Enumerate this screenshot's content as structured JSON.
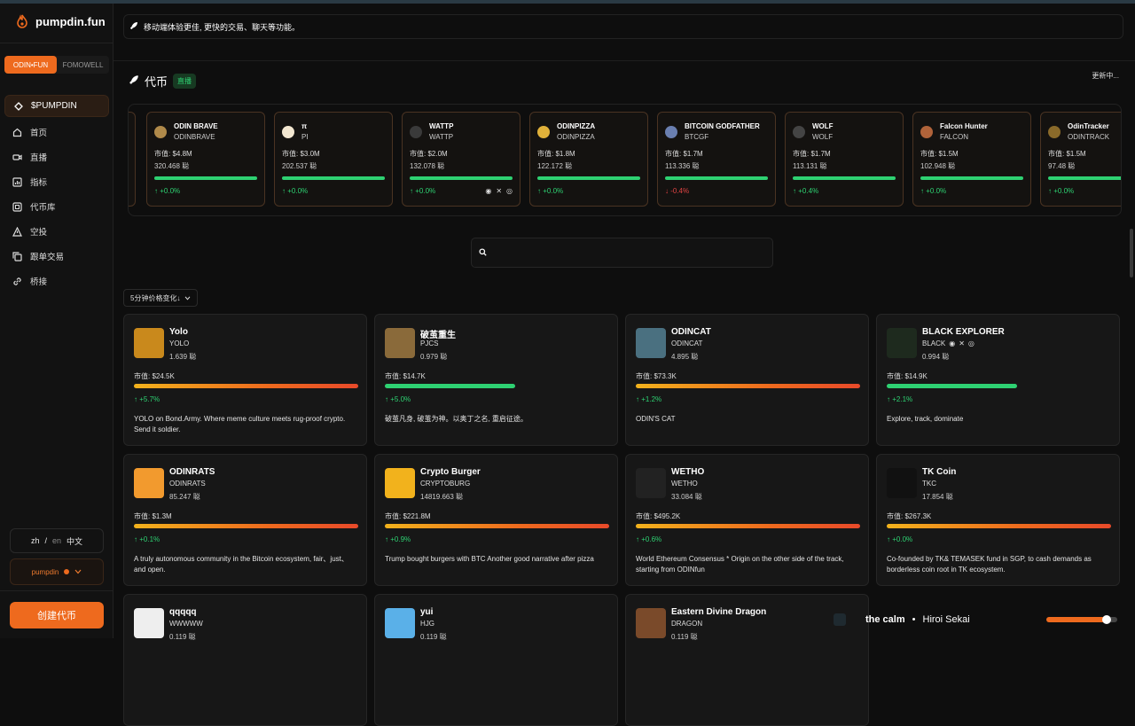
{
  "app": {
    "name": "pumpdin.fun"
  },
  "sidebar": {
    "switch": [
      "ODIN•FUN",
      "FOMOWELL"
    ],
    "items": [
      {
        "label": "$PUMPDIN",
        "icon": "diamond-icon"
      },
      {
        "label": "首页",
        "icon": "home-icon"
      },
      {
        "label": "直播",
        "icon": "video-icon"
      },
      {
        "label": "指标",
        "icon": "chart-icon"
      },
      {
        "label": "代币库",
        "icon": "library-icon"
      },
      {
        "label": "空投",
        "icon": "airdrop-icon"
      },
      {
        "label": "跟单交易",
        "icon": "copy-icon"
      },
      {
        "label": "桥接",
        "icon": "link-icon"
      }
    ],
    "lang": {
      "zh": "zh",
      "sep": "/",
      "en": "en",
      "current": "中文"
    },
    "user": "pumpdin",
    "create_label": "创建代币"
  },
  "banner": {
    "text": "移动端体验更佳, 更快的交易、聊天等功能。"
  },
  "section": {
    "title": "代币",
    "badge": "直播",
    "updating": "更新中..."
  },
  "ticker": [
    {
      "name": "ODIN BRAVE",
      "symbol": "ODINBRAVE",
      "cap": "市值: $4.8M",
      "holders": "320.468 聪",
      "change": "↑ +0.0%",
      "color": "#b08a4a"
    },
    {
      "name": "π",
      "symbol": "PI",
      "cap": "市值: $3.0M",
      "holders": "202.537 聪",
      "change": "↑ +0.0%",
      "color": "#f2e6d0"
    },
    {
      "name": "WATTP",
      "symbol": "WATTP",
      "cap": "市值: $2.0M",
      "holders": "132.078 聪",
      "change": "↑ +0.0%",
      "color": "#3a3a3a",
      "social": true
    },
    {
      "name": "ODINPIZZA",
      "symbol": "ODINPIZZA",
      "cap": "市值: $1.8M",
      "holders": "122.172 聪",
      "change": "↑ +0.0%",
      "color": "#e0b13a"
    },
    {
      "name": "BITCOIN GODFATHER",
      "symbol": "BTCGF",
      "cap": "市值: $1.7M",
      "holders": "113.336 聪",
      "change": "↓ -0.4%",
      "color": "#6a7fb0",
      "neg": true
    },
    {
      "name": "WOLF",
      "symbol": "WOLF",
      "cap": "市值: $1.7M",
      "holders": "113.131 聪",
      "change": "↑ +0.4%",
      "color": "#444"
    },
    {
      "name": "Falcon Hunter",
      "symbol": "FALCON",
      "cap": "市值: $1.5M",
      "holders": "102.948 聪",
      "change": "↑ +0.0%",
      "color": "#b0633a"
    },
    {
      "name": "OdinTracker",
      "symbol": "ODINTRACK",
      "cap": "市值: $1.5M",
      "holders": "97.48 聪",
      "change": "↑ +0.0%",
      "color": "#8a6a2a"
    }
  ],
  "search": {
    "placeholder": ""
  },
  "sort": {
    "label": "5分钟价格变化↓"
  },
  "cards": [
    {
      "name": "Yolo",
      "symbol": "YOLO",
      "holders": "1.639 聪",
      "cap": "市值: $24.5K",
      "change": "↑ +5.7%",
      "desc": "YOLO on Bond.Army. Where meme culture meets rug-proof crypto. Send it soldier.",
      "bar": "orange",
      "progress": 1.0,
      "color": "#c9891c"
    },
    {
      "name": "破茧重生",
      "symbol": "PJCS",
      "holders": "0.979 聪",
      "cap": "市值: $14.7K",
      "change": "↑ +5.0%",
      "desc": "破茧凡身, 破茧为神。以奥丁之名, 重启征途。",
      "bar": "green",
      "progress": 0.58,
      "color": "#8a6a3a"
    },
    {
      "name": "ODINCAT",
      "symbol": "ODINCAT",
      "holders": "4.895 聪",
      "cap": "市值: $73.3K",
      "change": "↑ +1.2%",
      "desc": "ODIN'S CAT",
      "bar": "orange",
      "progress": 1.0,
      "color": "#4a7080"
    },
    {
      "name": "BLACK EXPLORER",
      "symbol": "BLACK",
      "holders": "0.994 聪",
      "cap": "市值: $14.9K",
      "change": "↑ +2.1%",
      "desc": "Explore, track, dominate",
      "bar": "green",
      "progress": 0.58,
      "color": "#1e2a1e",
      "social": true
    },
    {
      "name": "ODINRATS",
      "symbol": "ODINRATS",
      "holders": "85.247 聪",
      "cap": "市值: $1.3M",
      "change": "↑ +0.1%",
      "desc": "A truly autonomous community in the Bitcoin ecosystem, fair、just、and open.",
      "bar": "orange",
      "progress": 1.0,
      "color": "#f29a2e"
    },
    {
      "name": "Crypto Burger",
      "symbol": "CRYPTOBURG",
      "holders": "14819.663 聪",
      "cap": "市值: $221.8M",
      "change": "↑ +0.9%",
      "desc": "Trump bought burgers with BTC Another good narrative after pizza",
      "bar": "orange",
      "progress": 1.0,
      "color": "#f2b21c"
    },
    {
      "name": "WETHO",
      "symbol": "WETHO",
      "holders": "33.084 聪",
      "cap": "市值: $495.2K",
      "change": "↑ +0.6%",
      "desc": "World Ethereum Consensus * Origin on the other side of the track, starting from ODINfun",
      "bar": "orange",
      "progress": 1.0,
      "color": "#222"
    },
    {
      "name": "TK Coin",
      "symbol": "TKC",
      "holders": "17.854 聪",
      "cap": "市值: $267.3K",
      "change": "↑ +0.0%",
      "desc": "Co-founded by TK& TEMASEK fund in SGP, to cash demands as borderless coin root in TK ecosystem.",
      "bar": "orange",
      "progress": 1.0,
      "color": "#111"
    },
    {
      "name": "qqqqq",
      "symbol": "WWWWW",
      "holders": "0.119 聪",
      "cap": "",
      "change": "",
      "desc": "",
      "bar": "none",
      "progress": 0,
      "color": "#eee"
    },
    {
      "name": "yui",
      "symbol": "HJG",
      "holders": "0.119 聪",
      "cap": "",
      "change": "",
      "desc": "",
      "bar": "none",
      "progress": 0,
      "color": "#5ab0e8"
    },
    {
      "name": "Eastern Divine Dragon",
      "symbol": "DRAGON",
      "holders": "0.119 聪",
      "cap": "",
      "change": "",
      "desc": "",
      "bar": "none",
      "progress": 0,
      "color": "#7a4a2a"
    }
  ],
  "player": {
    "track": "the calm",
    "dot": "•",
    "artist": "Hiroi Sekai",
    "progress": 0.85
  },
  "colors": {
    "accent": "#ee6a1e",
    "green": "#2ed172",
    "red": "#e24444"
  }
}
